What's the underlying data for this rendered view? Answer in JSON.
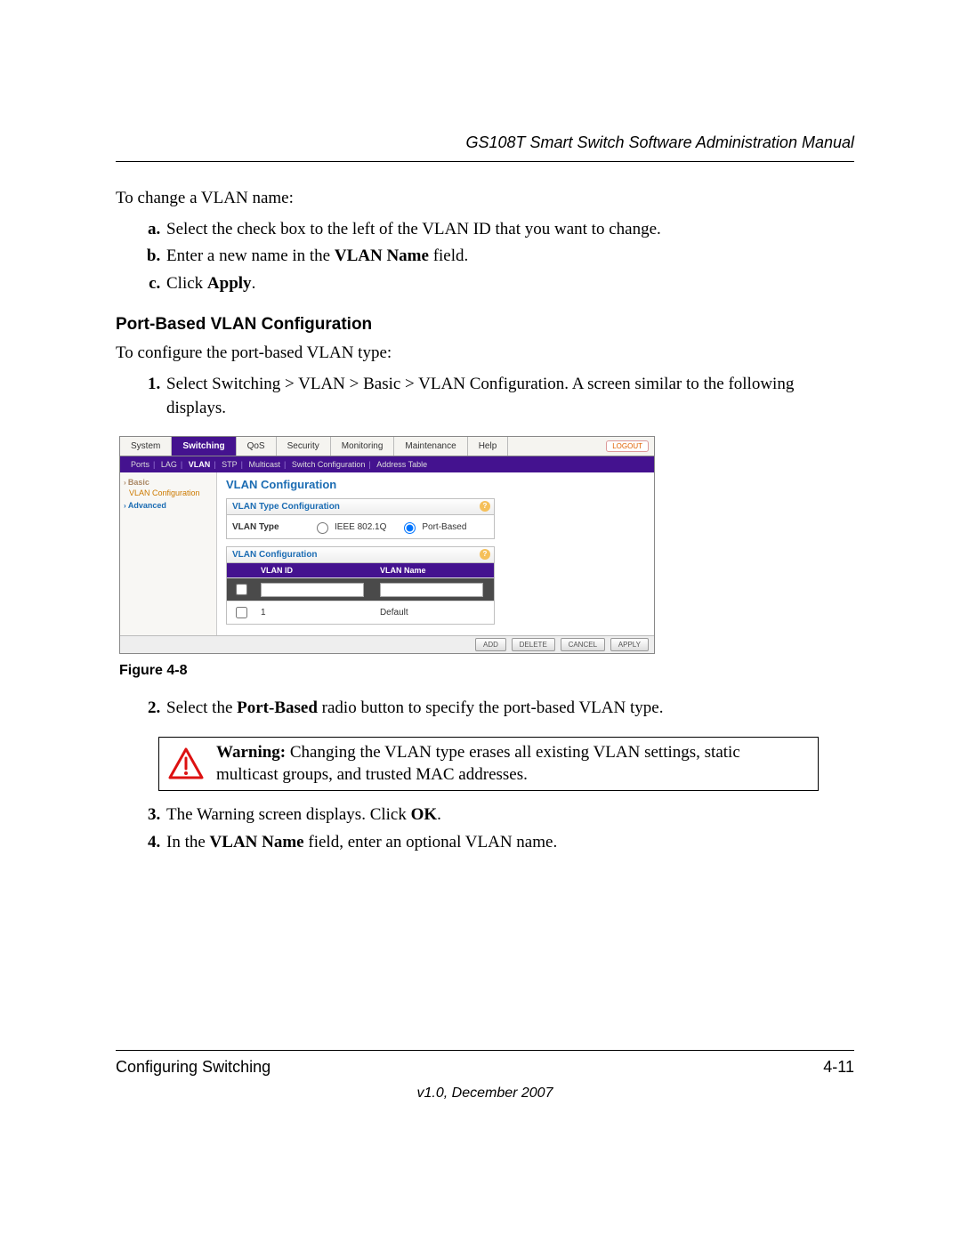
{
  "header_title": "GS108T Smart Switch Software Administration Manual",
  "intro1": "To change a VLAN name:",
  "steps_letters": {
    "a": "Select the check box to the left of the VLAN ID that you want to change.",
    "b_pre": "Enter a new name in the ",
    "b_bold": "VLAN Name",
    "b_post": " field.",
    "c_pre": "Click ",
    "c_bold": "Apply",
    "c_post": "."
  },
  "section_title": "Port-Based VLAN Configuration",
  "intro2": "To configure the port-based VLAN type:",
  "num1": "Select Switching > VLAN > Basic > VLAN Configuration. A screen similar to the following displays.",
  "figcap": "Figure 4-8",
  "num2_pre": "Select the ",
  "num2_bold": "Port-Based",
  "num2_post": " radio button to specify the port-based VLAN type.",
  "warn_label": "Warning:",
  "warn_text1": " Changing the VLAN type erases all existing VLAN settings, static",
  "warn_text2": "multicast groups, and trusted MAC addresses.",
  "num3_pre": "The Warning screen displays. Click ",
  "num3_bold": "OK",
  "num3_post": ".",
  "num4_pre": "In the ",
  "num4_bold": "VLAN Name",
  "num4_post": " field, enter an optional VLAN name.",
  "footer_left": "Configuring Switching",
  "footer_right": "4-11",
  "version": "v1.0, December 2007",
  "ui": {
    "tabs": [
      "System",
      "Switching",
      "QoS",
      "Security",
      "Monitoring",
      "Maintenance",
      "Help"
    ],
    "active_tab": "Switching",
    "logout": "LOGOUT",
    "subtabs": [
      "Ports",
      "LAG",
      "VLAN",
      "STP",
      "Multicast",
      "Switch Configuration",
      "Address Table"
    ],
    "active_sub": "VLAN",
    "side": {
      "basic": "Basic",
      "vlan_cfg": "VLAN Configuration",
      "advanced": "Advanced"
    },
    "main_title": "VLAN Configuration",
    "type_panel": "VLAN Type Configuration",
    "type_label": "VLAN Type",
    "type_opt1": "IEEE 802.1Q",
    "type_opt2": "Port-Based",
    "cfg_panel": "VLAN Configuration",
    "col_id": "VLAN ID",
    "col_name": "VLAN Name",
    "row1_id": "1",
    "row1_name": "Default",
    "buttons": [
      "ADD",
      "DELETE",
      "CANCEL",
      "APPLY"
    ],
    "help_glyph": "?"
  }
}
